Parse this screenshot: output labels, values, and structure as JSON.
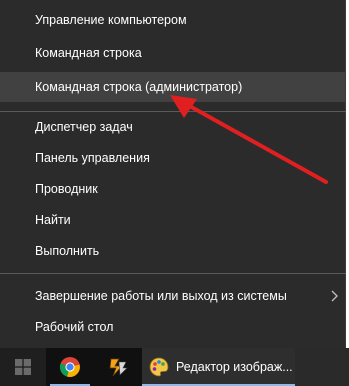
{
  "menu": {
    "items": [
      {
        "label": "Управление компьютером"
      },
      {
        "label": "Командная строка"
      },
      {
        "label": "Командная строка (администратор)"
      },
      {
        "label": "Диспетчер задач"
      },
      {
        "label": "Панель управления"
      },
      {
        "label": "Проводник"
      },
      {
        "label": "Найти"
      },
      {
        "label": "Выполнить"
      },
      {
        "label": "Завершение работы или выход из системы"
      },
      {
        "label": "Рабочий стол"
      }
    ]
  },
  "taskbar": {
    "start_icon": "windows-logo-icon",
    "apps": [
      {
        "icon": "chrome-icon"
      },
      {
        "icon": "winamp-icon"
      }
    ],
    "active_window": {
      "icon": "paint-palette-icon",
      "label": "Редактор изображ..."
    }
  },
  "annotation": {
    "color": "#e02020"
  },
  "colors": {
    "menu_bg": "#2b2b2b",
    "menu_highlight": "#414141",
    "taskbar_bg": "#101010"
  }
}
